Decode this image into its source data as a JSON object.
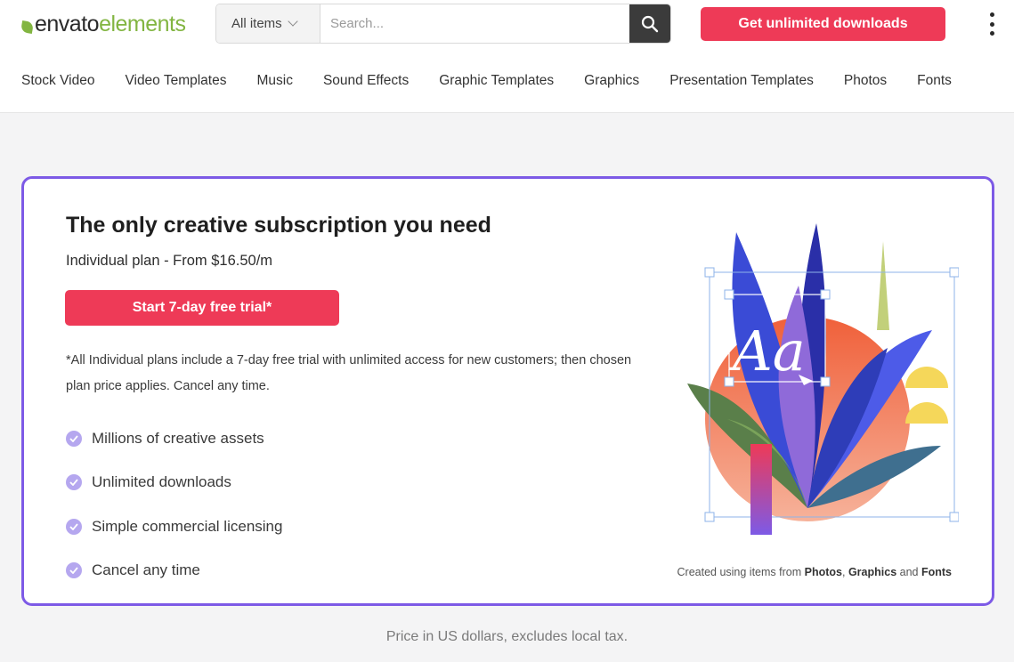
{
  "header": {
    "logo": {
      "part1": "envato",
      "part2": "elements"
    },
    "search": {
      "category": "All items",
      "placeholder": "Search..."
    },
    "cta_label": "Get unlimited downloads"
  },
  "nav": [
    "Stock Video",
    "Video Templates",
    "Music",
    "Sound Effects",
    "Graphic Templates",
    "Graphics",
    "Presentation Templates",
    "Photos",
    "Fonts"
  ],
  "promo": {
    "title": "The only creative subscription you need",
    "plan": "Individual plan - From $16.50/m",
    "cta_label": "Start 7-day free trial*",
    "disclaimer": "*All Individual plans include a 7-day free trial with unlimited access for new customers; then chosen plan price applies. Cancel any time.",
    "features": [
      "Millions of creative assets",
      "Unlimited downloads",
      "Simple commercial licensing",
      "Cancel any time"
    ],
    "art_text": "Aa",
    "credit": {
      "prefix": "Created using items from",
      "item1": "Photos",
      "sep1": ",",
      "item2": "Graphics",
      "sep2": "and",
      "item3": "Fonts"
    }
  },
  "footer_note": "Price in US dollars, excludes local tax.",
  "colors": {
    "accent": "#ee3a57",
    "brand_green": "#82b541",
    "card_border": "#7d5ae6",
    "check": "#b5a7ef"
  },
  "icons": [
    "envato-leaf-icon",
    "chevron-down-icon",
    "search-icon",
    "more-vertical-icon",
    "check-circle-icon"
  ]
}
